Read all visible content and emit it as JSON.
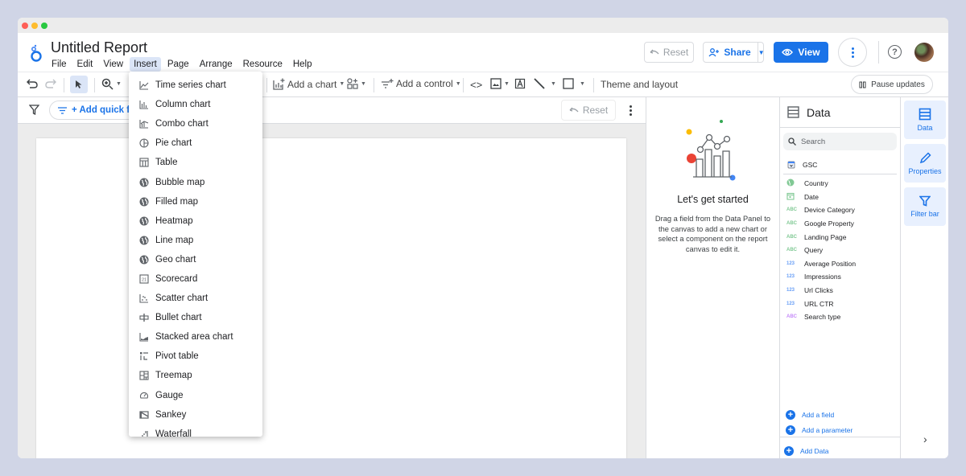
{
  "header": {
    "title": "Untitled Report",
    "menu": [
      "File",
      "Edit",
      "View",
      "Insert",
      "Page",
      "Arrange",
      "Resource",
      "Help"
    ],
    "active_menu": "Insert",
    "reset_label": "Reset",
    "share_label": "Share",
    "view_label": "View"
  },
  "toolbar": {
    "add_chart_label": "Add a chart",
    "add_control_label": "Add a control",
    "theme_label": "Theme and layout",
    "pause_label": "Pause updates"
  },
  "filterbar": {
    "add_quick_filter_label": "+ Add quick filter",
    "reset_label": "Reset"
  },
  "insert_menu": {
    "items": [
      {
        "label": "Time series chart",
        "icon": "time-series-icon"
      },
      {
        "label": "Column chart",
        "icon": "column-chart-icon"
      },
      {
        "label": "Combo chart",
        "icon": "combo-chart-icon"
      },
      {
        "label": "Pie chart",
        "icon": "pie-chart-icon"
      },
      {
        "label": "Table",
        "icon": "table-icon"
      },
      {
        "label": "Bubble map",
        "icon": "globe-icon"
      },
      {
        "label": "Filled map",
        "icon": "globe-icon"
      },
      {
        "label": "Heatmap",
        "icon": "globe-icon"
      },
      {
        "label": "Line map",
        "icon": "globe-icon"
      },
      {
        "label": "Geo chart",
        "icon": "globe-icon"
      },
      {
        "label": "Scorecard",
        "icon": "scorecard-icon"
      },
      {
        "label": "Scatter chart",
        "icon": "scatter-chart-icon"
      },
      {
        "label": "Bullet chart",
        "icon": "bullet-chart-icon"
      },
      {
        "label": "Stacked area chart",
        "icon": "area-chart-icon"
      },
      {
        "label": "Pivot table",
        "icon": "pivot-table-icon"
      },
      {
        "label": "Treemap",
        "icon": "treemap-icon"
      },
      {
        "label": "Gauge",
        "icon": "gauge-icon"
      },
      {
        "label": "Sankey",
        "icon": "sankey-icon"
      },
      {
        "label": "Waterfall",
        "icon": "waterfall-icon"
      }
    ]
  },
  "helper": {
    "title": "Let's get started",
    "text": "Drag a field from the Data Panel to the canvas to add a new chart or select a component on the report canvas to edit it."
  },
  "data_panel": {
    "title": "Data",
    "search_placeholder": "Search",
    "source": "GSC",
    "fields": [
      {
        "name": "Country",
        "type": "geo"
      },
      {
        "name": "Date",
        "type": "date"
      },
      {
        "name": "Device Category",
        "type": "ABC"
      },
      {
        "name": "Google Property",
        "type": "ABC"
      },
      {
        "name": "Landing Page",
        "type": "ABC"
      },
      {
        "name": "Query",
        "type": "ABC"
      },
      {
        "name": "Average Position",
        "type": "123"
      },
      {
        "name": "Impressions",
        "type": "123"
      },
      {
        "name": "Url Clicks",
        "type": "123"
      },
      {
        "name": "URL CTR",
        "type": "123"
      },
      {
        "name": "Search type",
        "type": "ABC-param"
      }
    ],
    "add_field_label": "Add a field",
    "add_parameter_label": "Add a parameter",
    "add_data_label": "Add Data"
  },
  "right_rail": {
    "items": [
      "Data",
      "Properties",
      "Filter bar"
    ]
  },
  "colors": {
    "accent": "#1a73e8",
    "active_menu_bg": "#dbe5f7",
    "dimension": "#81c995",
    "metric": "#669df6",
    "parameter": "#c58af9"
  }
}
